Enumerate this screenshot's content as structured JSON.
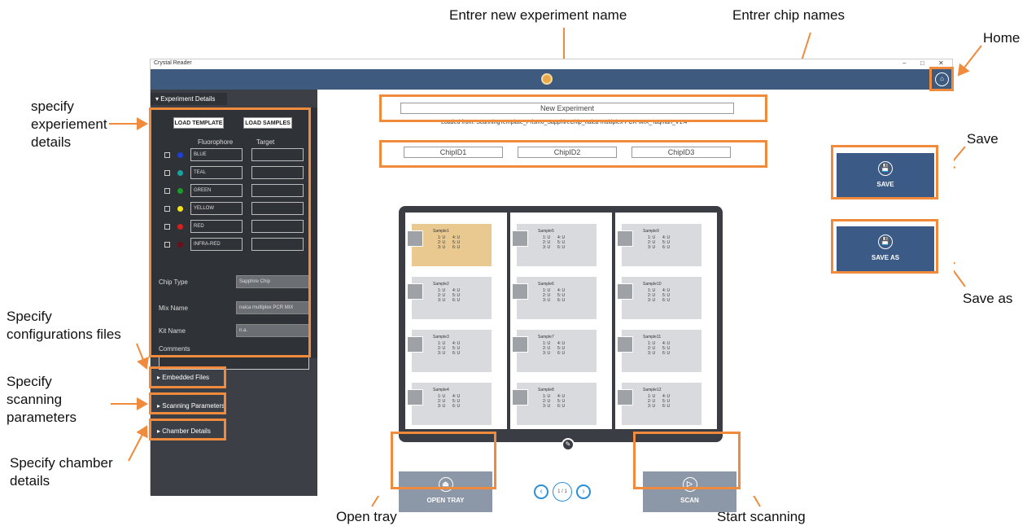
{
  "annotations": {
    "experiment_name": "Entrer new experiment name",
    "chip_names": "Entrer chip names",
    "home": "Home",
    "save": "Save",
    "save_as": "Save as",
    "experiment_details": "specify\nexperiement\ndetails",
    "config_files": "Specify\nconfigurations files",
    "scanning_params": "Specify\nscanning\nparameters",
    "chamber": "Specify chamber\ndetails",
    "open_tray": "Open tray",
    "start_scanning": "Start scanning"
  },
  "window": {
    "title": "Crystal Reader",
    "controls": [
      "–",
      "□",
      "✕"
    ]
  },
  "sidebar": {
    "tab": "▾ Experiment Details",
    "load_template": "LOAD TEMPLATE",
    "load_samples": "LOAD SAMPLES",
    "col_fluorophore": "Fluorophore",
    "col_target": "Target",
    "fluorophores": [
      {
        "name": "BLUE",
        "color": "#1f3fd6"
      },
      {
        "name": "TEAL",
        "color": "#18a3a0"
      },
      {
        "name": "GREEN",
        "color": "#1e9b2a"
      },
      {
        "name": "YELLOW",
        "color": "#f2e41a"
      },
      {
        "name": "RED",
        "color": "#d62020"
      },
      {
        "name": "INFRA-RED",
        "color": "#6b0f1a"
      }
    ],
    "chip_type_label": "Chip Type",
    "chip_type_value": "Sapphire Chip",
    "mix_name_label": "Mix Name",
    "mix_name_value": "naica multiplex PCR MIX",
    "kit_name_label": "Kit Name",
    "kit_name_value": "n.a.",
    "comments_label": "Comments",
    "embedded_files": "▸ Embedded Files",
    "scanning_parameters": "▸ Scanning Parameters",
    "chamber_details": "▸ Chamber Details"
  },
  "main": {
    "experiment_name": "New Experiment",
    "loaded_from": "Loaded from: ScanningTemplate_Prism6_SapphireChip_naica-multiplex-PCR-MIX_Taqman_V1.4",
    "chips": [
      "ChipID1",
      "ChipID2",
      "ChipID3"
    ],
    "samples": [
      "Sample1",
      "Sample2",
      "Sample3",
      "Sample4",
      "Sample5",
      "Sample6",
      "Sample7",
      "Sample8",
      "Sample9",
      "Sample10",
      "Sample11",
      "Sample12"
    ],
    "sample_values_left": "1: U\n2: U\n3: U",
    "sample_values_right": "4: U\n5: U\n6: U",
    "save": "SAVE",
    "save_as": "SAVE AS",
    "open_tray": "OPEN TRAY",
    "scan": "SCAN",
    "page": "1 / 1",
    "highlight_color": "#e9c98f"
  }
}
